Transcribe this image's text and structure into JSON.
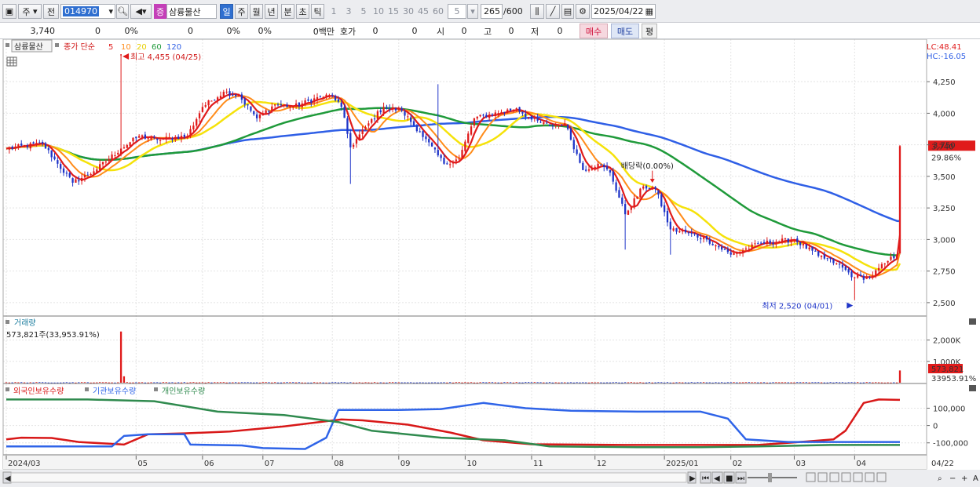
{
  "toolbar": {
    "period_type": "주",
    "prev_label": "전",
    "stock_code": "014970",
    "stock_badge": "증",
    "stock_name": "삼륭물산",
    "periods": [
      "일",
      "주",
      "월",
      "년",
      "분",
      "초",
      "틱"
    ],
    "intervals": [
      "1",
      "3",
      "5",
      "10",
      "15",
      "30",
      "45",
      "60"
    ],
    "interval_input": "5",
    "count": "265",
    "count_max": "/600",
    "date": "2025/04/22"
  },
  "quote": {
    "price": "3,740",
    "change": "0",
    "change_pct": "0%",
    "volume": "0",
    "vol_pct": "0%",
    "pct3": "0%",
    "amount": "0백만",
    "label_hoga": "호가",
    "hoga1": "0",
    "hoga2": "0",
    "label_open": "시",
    "open": "0",
    "label_high": "고",
    "high": "0",
    "label_low": "저",
    "low": "0",
    "buy_label": "매수",
    "sell_label": "매도",
    "eval_label": "평"
  },
  "colors": {
    "candle_up": "#e01b1b",
    "candle_down": "#1f35c8",
    "ma5": "#e01b1b",
    "ma10": "#ff8c1a",
    "ma20": "#f5e20a",
    "ma60": "#1f9a3a",
    "ma120": "#2f5fe6",
    "foreign": "#d81818",
    "institution": "#2f64e8",
    "individual": "#2f8a4e"
  },
  "chart_data": [
    {
      "type": "candlestick",
      "title": "삼륭물산",
      "legend": {
        "label": "종가 단순",
        "periods": [
          "5",
          "10",
          "20",
          "60",
          "120"
        ]
      },
      "right_labels": {
        "lc": "LC:48.41",
        "hc": "HC:-16.05"
      },
      "ylim": [
        2400,
        4400
      ],
      "yticks": [
        2500,
        2750,
        3000,
        3250,
        3500,
        3750,
        4000,
        4250
      ],
      "ytick_labels": [
        "2,500",
        "2,750",
        "3,000",
        "3,250",
        "3,500",
        "3,750",
        "4,000",
        "4,250"
      ],
      "current_price": 3740,
      "current_price_label": "3,740",
      "current_change_label": "29.86%",
      "annotations": {
        "high_label": "최고 4,455 (04/25)",
        "low_label": "최저 2,520 (04/01)",
        "dividend_label": "배당락(0.00%)"
      },
      "anchors": [
        [
          "2024-03-04",
          3720
        ],
        [
          "2024-03-20",
          3760
        ],
        [
          "2024-03-27",
          3600
        ],
        [
          "2024-04-03",
          3450
        ],
        [
          "2024-04-12",
          3540
        ],
        [
          "2024-04-25",
          3720
        ],
        [
          "2024-05-03",
          3820
        ],
        [
          "2024-05-13",
          3790
        ],
        [
          "2024-05-27",
          3820
        ],
        [
          "2024-06-03",
          4050
        ],
        [
          "2024-06-12",
          4170
        ],
        [
          "2024-06-19",
          4140
        ],
        [
          "2024-06-27",
          3960
        ],
        [
          "2024-07-05",
          4070
        ],
        [
          "2024-07-15",
          4050
        ],
        [
          "2024-07-26",
          4130
        ],
        [
          "2024-08-01",
          4140
        ],
        [
          "2024-08-06",
          4050
        ],
        [
          "2024-08-09",
          3730
        ],
        [
          "2024-08-19",
          3920
        ],
        [
          "2024-08-26",
          4050
        ],
        [
          "2024-09-03",
          4020
        ],
        [
          "2024-09-11",
          3850
        ],
        [
          "2024-09-23",
          3600
        ],
        [
          "2024-09-30",
          3640
        ],
        [
          "2024-10-07",
          3960
        ],
        [
          "2024-10-18",
          4010
        ],
        [
          "2024-10-25",
          4040
        ],
        [
          "2024-11-01",
          3950
        ],
        [
          "2024-11-11",
          3900
        ],
        [
          "2024-11-18",
          3920
        ],
        [
          "2024-11-26",
          3550
        ],
        [
          "2024-12-03",
          3600
        ],
        [
          "2024-12-09",
          3530
        ],
        [
          "2024-12-16",
          3200
        ],
        [
          "2024-12-24",
          3420
        ],
        [
          "2024-12-30",
          3400
        ],
        [
          "2025-01-06",
          3080
        ],
        [
          "2025-01-14",
          3050
        ],
        [
          "2025-01-22",
          3000
        ],
        [
          "2025-02-03",
          2880
        ],
        [
          "2025-02-17",
          2970
        ],
        [
          "2025-03-04",
          3000
        ],
        [
          "2025-03-14",
          2870
        ],
        [
          "2025-03-24",
          2810
        ],
        [
          "2025-04-01",
          2700
        ],
        [
          "2025-04-08",
          2700
        ],
        [
          "2025-04-16",
          2830
        ],
        [
          "2025-04-21",
          2880
        ],
        [
          "2025-04-22",
          3740
        ]
      ]
    },
    {
      "type": "bar",
      "title": "거래량",
      "info_label": "573,821주(33,953.91%)",
      "ylim": [
        0,
        2500000
      ],
      "yticks": [
        1000000,
        2000000
      ],
      "ytick_labels": [
        "1,000K",
        "2,000K"
      ],
      "current_label": "573,821",
      "current_sub_label": "33953.91%",
      "spikes": [
        [
          "2024-04-25",
          2400000
        ],
        [
          "2024-04-26",
          300000
        ],
        [
          "2025-04-22",
          573821
        ]
      ],
      "baseline": 20000
    },
    {
      "type": "line",
      "series_names": [
        "외국인보유수량",
        "기관보유수량",
        "개인보유수량"
      ],
      "ylim": [
        -160000,
        170000
      ],
      "yticks": [
        100000,
        0,
        -100000
      ],
      "ytick_labels": [
        "100,000",
        "0",
        "-100,000"
      ],
      "series": [
        {
          "name": "외국인보유수량",
          "points": [
            [
              "2024-03-04",
              -80000
            ],
            [
              "2024-03-10",
              -70000
            ],
            [
              "2024-03-25",
              -72000
            ],
            [
              "2024-04-05",
              -95000
            ],
            [
              "2024-04-20",
              -105000
            ],
            [
              "2024-04-26",
              -110000
            ],
            [
              "2024-05-08",
              -50000
            ],
            [
              "2024-05-25",
              -45000
            ],
            [
              "2024-06-15",
              -35000
            ],
            [
              "2024-07-10",
              -5000
            ],
            [
              "2024-07-30",
              25000
            ],
            [
              "2024-08-06",
              35000
            ],
            [
              "2024-08-15",
              30000
            ],
            [
              "2024-09-05",
              5000
            ],
            [
              "2024-09-25",
              -40000
            ],
            [
              "2024-10-10",
              -85000
            ],
            [
              "2024-11-01",
              -108000
            ],
            [
              "2024-12-15",
              -112000
            ],
            [
              "2025-02-15",
              -112000
            ],
            [
              "2025-03-10",
              -92000
            ],
            [
              "2025-03-22",
              -80000
            ],
            [
              "2025-03-27",
              -30000
            ],
            [
              "2025-04-01",
              50000
            ],
            [
              "2025-04-05",
              130000
            ],
            [
              "2025-04-12",
              150000
            ],
            [
              "2025-04-22",
              148000
            ]
          ]
        },
        {
          "name": "기관보유수량",
          "points": [
            [
              "2024-03-04",
              -120000
            ],
            [
              "2024-04-10",
              -120000
            ],
            [
              "2024-04-22",
              -120000
            ],
            [
              "2024-04-27",
              -60000
            ],
            [
              "2024-05-08",
              -50000
            ],
            [
              "2024-05-25",
              -50000
            ],
            [
              "2024-05-28",
              -110000
            ],
            [
              "2024-06-20",
              -115000
            ],
            [
              "2024-07-01",
              -130000
            ],
            [
              "2024-07-20",
              -135000
            ],
            [
              "2024-07-30",
              -70000
            ],
            [
              "2024-08-05",
              90000
            ],
            [
              "2024-09-01",
              90000
            ],
            [
              "2024-09-20",
              95000
            ],
            [
              "2024-10-10",
              130000
            ],
            [
              "2024-10-30",
              100000
            ],
            [
              "2024-11-20",
              85000
            ],
            [
              "2024-12-20",
              80000
            ],
            [
              "2025-01-20",
              80000
            ],
            [
              "2025-02-01",
              40000
            ],
            [
              "2025-02-10",
              -80000
            ],
            [
              "2025-03-01",
              -95000
            ],
            [
              "2025-04-22",
              -95000
            ]
          ]
        },
        {
          "name": "개인보유수량",
          "points": [
            [
              "2024-03-04",
              150000
            ],
            [
              "2024-04-10",
              150000
            ],
            [
              "2024-05-10",
              140000
            ],
            [
              "2024-06-10",
              80000
            ],
            [
              "2024-07-10",
              60000
            ],
            [
              "2024-08-05",
              20000
            ],
            [
              "2024-08-20",
              -30000
            ],
            [
              "2024-09-20",
              -70000
            ],
            [
              "2024-10-20",
              -85000
            ],
            [
              "2024-11-10",
              -120000
            ],
            [
              "2024-12-20",
              -125000
            ],
            [
              "2025-01-20",
              -125000
            ],
            [
              "2025-02-15",
              -120000
            ],
            [
              "2025-03-20",
              -112000
            ],
            [
              "2025-04-22",
              -112000
            ]
          ]
        }
      ]
    }
  ],
  "time_axis": {
    "labels": [
      [
        "2024-03-04",
        "2024/03"
      ],
      [
        "2024-05-02",
        "05"
      ],
      [
        "2024-06-03",
        "06"
      ],
      [
        "2024-07-01",
        "07"
      ],
      [
        "2024-08-01",
        "08"
      ],
      [
        "2024-09-02",
        "09"
      ],
      [
        "2024-10-02",
        "10"
      ],
      [
        "2024-11-01",
        "11"
      ],
      [
        "2024-12-02",
        "12"
      ],
      [
        "2025-01-02",
        "2025/01"
      ],
      [
        "2025-02-03",
        "02"
      ],
      [
        "2025-03-04",
        "03"
      ],
      [
        "2025-04-01",
        "04"
      ]
    ],
    "right_label": "04/22"
  },
  "nav_icons": [
    "step-back-icon",
    "play-icon",
    "stop-icon",
    "fast-forward-icon",
    "zoom-out-icon",
    "minus-icon",
    "plus-icon",
    "text-icon"
  ]
}
